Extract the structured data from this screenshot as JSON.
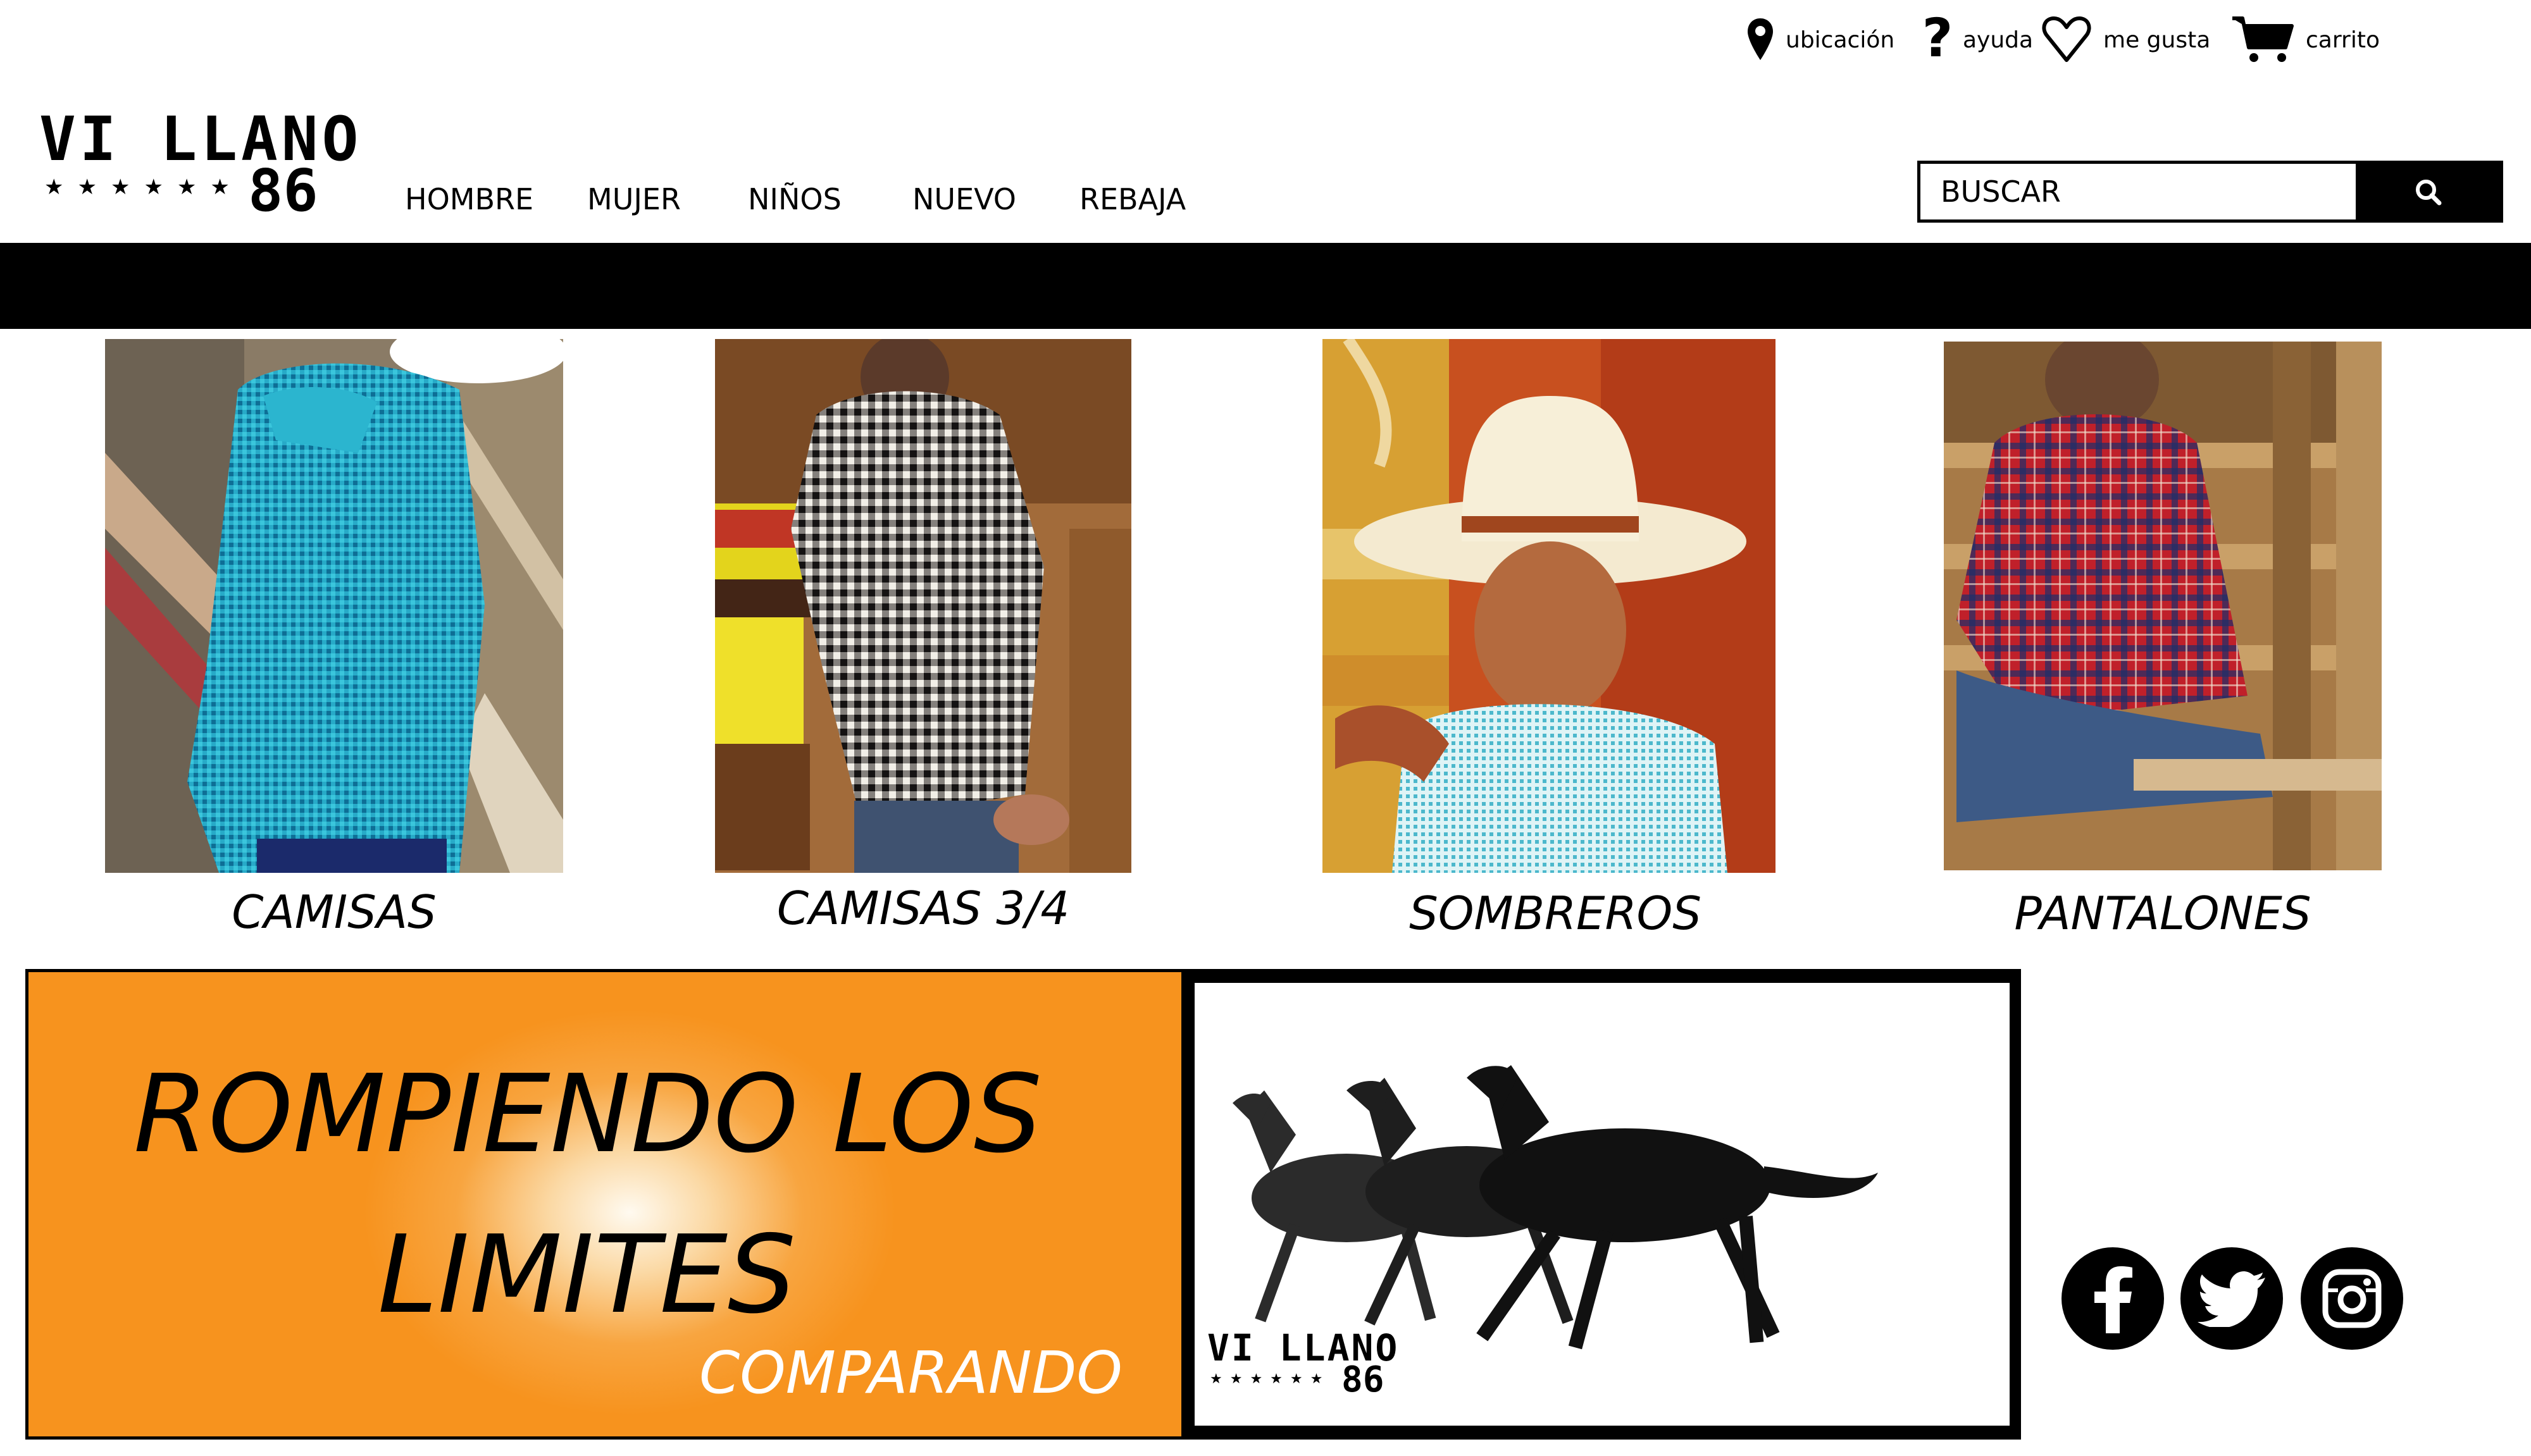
{
  "top_links": {
    "location": "ubicación",
    "help": "ayuda",
    "likes": "me gusta",
    "cart": "carrito"
  },
  "logo": {
    "line1": "VI LLANO",
    "stars": "★★★★★★",
    "number": "86"
  },
  "nav": {
    "items": [
      "HOMBRE",
      "MUJER",
      "NIÑOS",
      "NUEVO",
      "REBAJA"
    ]
  },
  "search": {
    "placeholder": "BUSCAR",
    "icon": "search-icon"
  },
  "categories": [
    {
      "label": "CAMISAS"
    },
    {
      "label": "CAMISAS 3/4"
    },
    {
      "label": "SOMBREROS"
    },
    {
      "label": "PANTALONES"
    }
  ],
  "promo": {
    "line1": "ROMPIENDO LOS",
    "line2": "LIMITES",
    "sub": "COMPARANDO"
  },
  "horse_banner": {
    "logo_line1": "VI LLANO",
    "logo_stars": "★★★★★★",
    "logo_number": "86"
  },
  "social": [
    "facebook-icon",
    "twitter-icon",
    "instagram-icon"
  ],
  "colors": {
    "accent_orange": "#f7931e",
    "black": "#000000",
    "white": "#ffffff"
  }
}
